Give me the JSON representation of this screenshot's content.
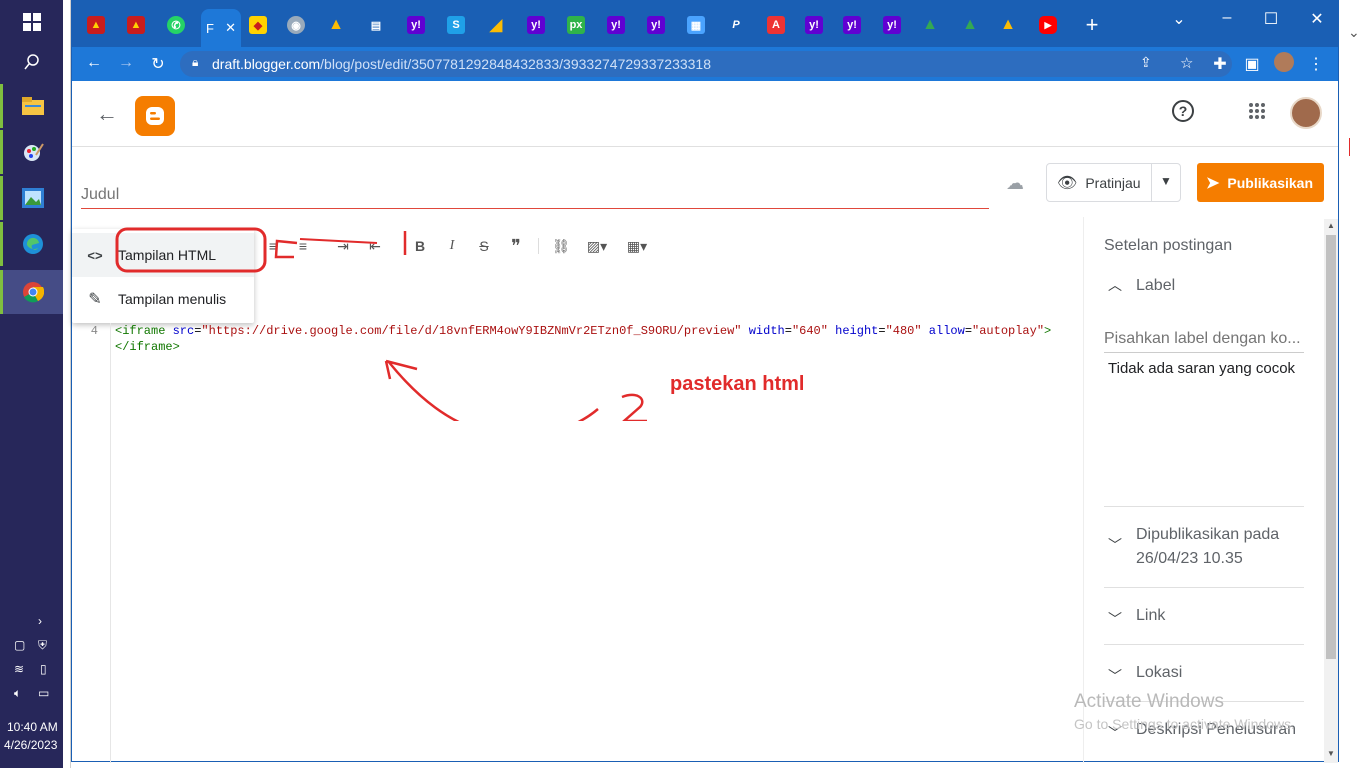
{
  "taskbar": {
    "time": "10:40 AM",
    "date": "4/26/2023"
  },
  "browser": {
    "active_tab_label": "F",
    "url_host": "draft.blogger.com",
    "url_path": "/blog/post/edit/3507781292848432833/3933274729337233318"
  },
  "blogger": {
    "title_placeholder": "Judul",
    "preview_label": "Pratinjau",
    "publish_label": "Publikasikan",
    "view_menu": [
      {
        "label": "Tampilan HTML"
      },
      {
        "label": "Tampilan menulis"
      }
    ],
    "format_toolbar": [
      "B",
      "I"
    ],
    "editor": {
      "line_number": "4",
      "code_line_1": {
        "open": "<iframe ",
        "a1": "src",
        "v1": "\"https://drive.google.com/file/d/18vnfERM4owY9IBZNmVr2ETzn0f_S9ORU/preview\"",
        "a2": "width",
        "v2": "\"640\"",
        "a3": "height",
        "v3": "\"480\"",
        "a4": "allow",
        "v4": "\"autoplay\"",
        "close": ">"
      },
      "code_line_2": "</iframe>"
    },
    "annotation_text": "pastekan html",
    "annotation_number": "2"
  },
  "sidebar": {
    "title": "Setelan postingan",
    "label_heading": "Label",
    "label_placeholder": "Pisahkan label dengan ko...",
    "no_suggestions": "Tidak ada saran yang cocok",
    "published_heading": "Dipublikasikan pada",
    "published_value": "26/04/23 10.35",
    "link_heading": "Link",
    "location_heading": "Lokasi",
    "search_desc_heading": "Deskripsi Penelusuran"
  },
  "watermark": {
    "line1": "Activate Windows",
    "line2": "Go to Settings to activate Windows."
  },
  "colors": {
    "chrome_blue": "#1a5fb4",
    "blogger_orange": "#f57d00",
    "annotation_red": "#e12b2b"
  }
}
